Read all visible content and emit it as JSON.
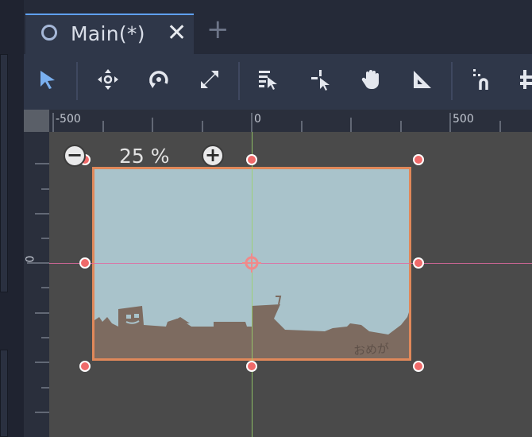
{
  "tabs": [
    {
      "label": "Main(*)",
      "icon": "scene-circle-icon",
      "close_glyph": "✕"
    }
  ],
  "add_tab_glyph": "+",
  "toolbar": {
    "tools": [
      "select-tool",
      "move-tool",
      "rotate-tool",
      "scale-tool",
      "list-select-tool",
      "pivot-tool",
      "pan-tool",
      "ruler-tool",
      "smart-snap-tool",
      "grid-snap-tool"
    ],
    "active_tool": "select-tool"
  },
  "ruler": {
    "horizontal_labels": [
      "-500",
      "0",
      "500"
    ],
    "vertical_label": "0"
  },
  "zoom": {
    "minus_glyph": "−",
    "plus_glyph": "+",
    "level_text": "25 %"
  },
  "scene_art": {
    "watermark_text": "おめが"
  },
  "colors": {
    "accent": "#5fa0f0",
    "selection_border": "#e0885a",
    "handle": "#f06a6a",
    "sky": "#a9c3cb",
    "ground": "#7d6b60",
    "x_axis": "#e06aa0",
    "y_axis": "#9ad26a"
  }
}
